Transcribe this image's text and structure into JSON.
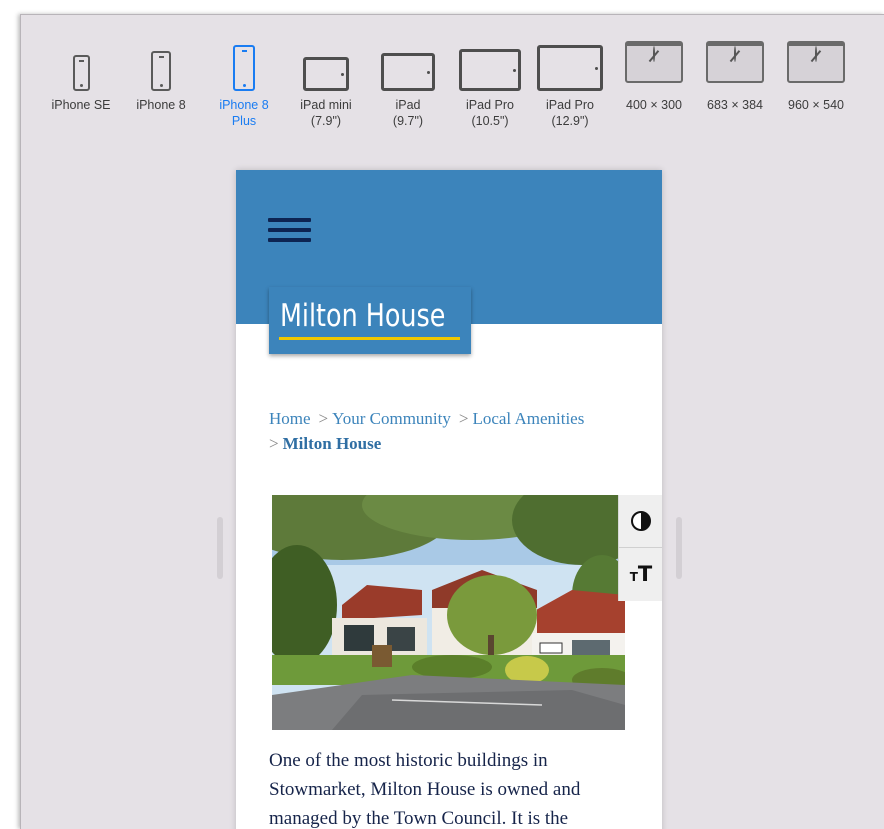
{
  "devices": [
    {
      "label": "iPhone SE",
      "kind": "phone"
    },
    {
      "label": "iPhone 8",
      "kind": "phone"
    },
    {
      "label": "iPhone 8\nPlus",
      "kind": "phone",
      "selected": true
    },
    {
      "label": "iPad mini\n(7.9\")",
      "kind": "tablet"
    },
    {
      "label": "iPad\n(9.7\")",
      "kind": "tablet"
    },
    {
      "label": "iPad Pro\n(10.5\")",
      "kind": "tablet"
    },
    {
      "label": "iPad Pro\n(12.9\")",
      "kind": "tablet"
    },
    {
      "label": "400 × 300",
      "kind": "browser"
    },
    {
      "label": "683 × 384",
      "kind": "browser"
    },
    {
      "label": "960 × 540",
      "kind": "browser"
    }
  ],
  "site": {
    "header_color": "#3c84bb",
    "logo_text": "Milton House",
    "logo_underline_color": "#f0c800",
    "menu_icon": "hamburger-menu-icon"
  },
  "breadcrumb": {
    "home": "Home",
    "community": "Your Community",
    "amenities": "Local Amenities",
    "current": "Milton House",
    "separator": ">"
  },
  "accessibility": {
    "contrast_icon": "contrast-icon",
    "text_size_icon": "text-size-icon"
  },
  "photo": {
    "subject": "Milton House building with trees and parking area"
  },
  "body_text": "One of the most historic buildings in Stowmarket, Milton House is owned and managed by the Town Council. It is the"
}
